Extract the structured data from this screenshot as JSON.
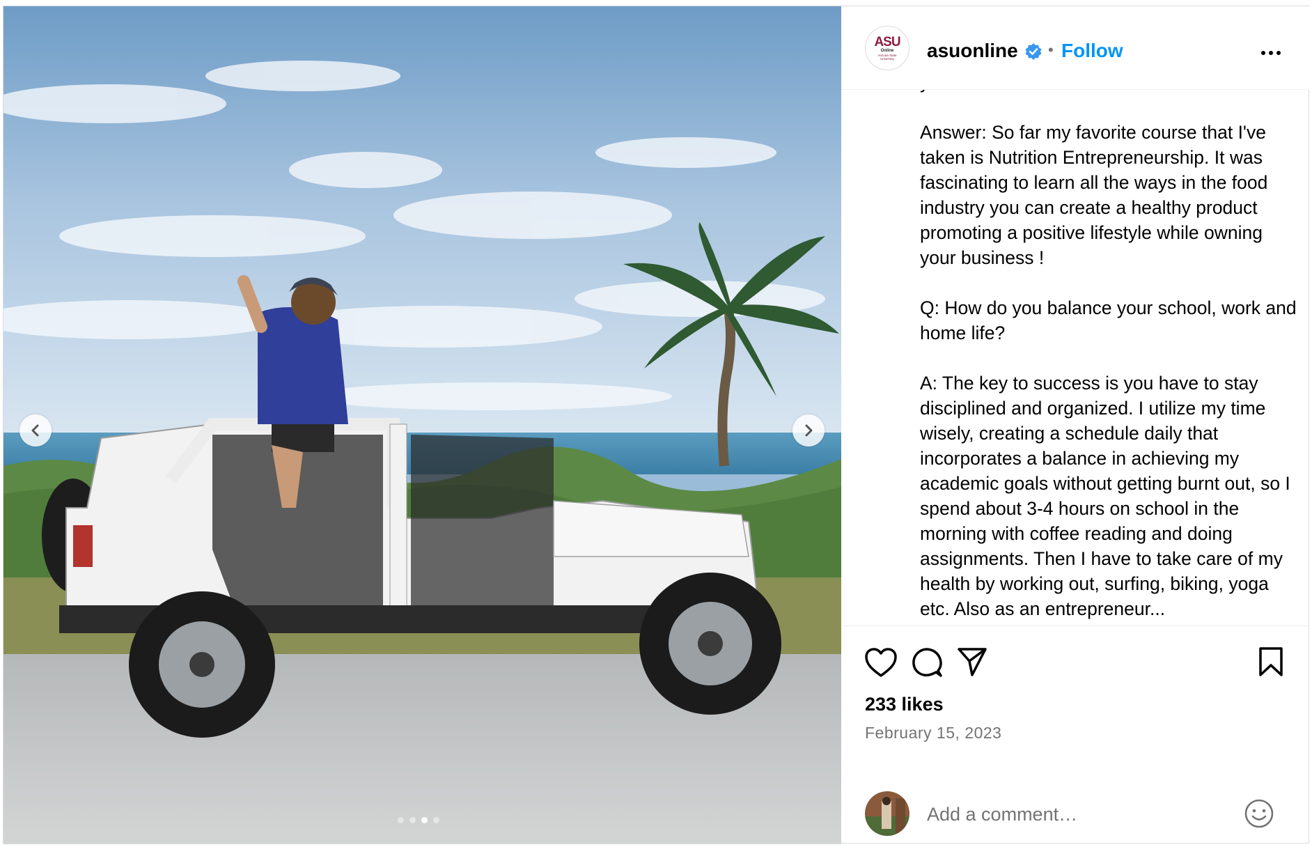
{
  "post": {
    "username": "asuonline",
    "follow_label": "Follow",
    "separator": "•",
    "logo": {
      "mark": "ASU",
      "line1": "Online",
      "line2": "Arizona State University"
    },
    "caption": "you've taken thus far?\n\nAnswer: So far my favorite course that I've taken is Nutrition Entrepreneurship. It was fascinating to learn all the ways in the food industry you can create a healthy product promoting a positive lifestyle while owning your business !\n\nQ: How do you balance your school, work and home life?\n\nA: The key to success is you have to stay disciplined and organized. I utilize my time wisely, creating a schedule daily that incorporates a balance in achieving my academic goals without getting burnt out, so I spend about 3-4 hours on school in the morning with coffee reading and doing assignments. Then I have to take care of my health by working out, surfing, biking, yoga etc. Also as an entrepreneur...",
    "likes": "233 likes",
    "date": "February 15, 2023",
    "carousel": {
      "slide_count": 4,
      "active_index": 2
    }
  },
  "comment": {
    "placeholder": "Add a comment…"
  },
  "icons": {
    "verified": "verified-badge-icon",
    "more": "more-options-icon",
    "like": "heart-icon",
    "comment": "comment-icon",
    "share": "share-icon",
    "save": "bookmark-icon",
    "emoji": "emoji-icon",
    "prev": "chevron-left-icon",
    "next": "chevron-right-icon"
  },
  "colors": {
    "accent": "#0095f6",
    "asu_maroon": "#8c1d40",
    "secondary_text": "#737373",
    "border": "#dbdbdb"
  }
}
